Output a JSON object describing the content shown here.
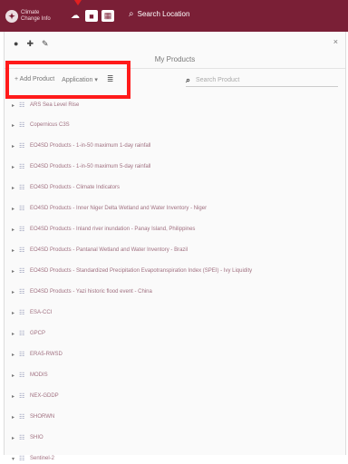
{
  "topbar": {
    "logo_text": "Climate Change Info",
    "search_label": "Search Location",
    "accent": "#7a1f36"
  },
  "panel": {
    "tools": [
      "●",
      "✚",
      "✎"
    ],
    "close": "×",
    "title": "My Products",
    "add_product": "+ Add Product",
    "application": "Application ▾",
    "list_icon": "≣",
    "search_placeholder": "Search Product"
  },
  "tree": [
    {
      "label": "ARS Sea Level Rise",
      "icon": "list-icon",
      "expanded": false
    },
    {
      "label": "Copernicus C3S",
      "icon": "list-icon",
      "expanded": false
    },
    {
      "label": "EO4SD Products - 1-in-50 maximum 1-day rainfall",
      "icon": "list-icon",
      "expanded": false
    },
    {
      "label": "EO4SD Products - 1-in-50 maximum 5-day rainfall",
      "icon": "list-icon",
      "expanded": false
    },
    {
      "label": "EO4SD Products - Climate Indicators",
      "icon": "list-icon",
      "expanded": false
    },
    {
      "label": "EO4SD Products - Inner Niger Delta Wetland and Water Inventory - Niger",
      "icon": "list-icon",
      "expanded": false
    },
    {
      "label": "EO4SD Products - Inland river inundation - Panay Island, Philippines",
      "icon": "list-icon",
      "expanded": false
    },
    {
      "label": "EO4SD Products - Pantanal Wetland and Water Inventory - Brazil",
      "icon": "list-icon",
      "expanded": false
    },
    {
      "label": "EO4SD Products - Standardized Precipitation Evapotranspiration Index (SPEI) - Ivy Liquidity",
      "icon": "list-icon",
      "expanded": false
    },
    {
      "label": "EO4SD Products - Yazi historic flood event - China",
      "icon": "list-icon",
      "expanded": false
    },
    {
      "label": "ESA-CCI",
      "icon": "list-icon",
      "expanded": false
    },
    {
      "label": "GPCP",
      "icon": "list-icon",
      "expanded": false
    },
    {
      "label": "ERA5-RWSD",
      "icon": "list-icon",
      "expanded": false
    },
    {
      "label": "MODIS",
      "icon": "list-icon",
      "expanded": false
    },
    {
      "label": "NEX-GDDP",
      "icon": "list-icon",
      "expanded": false
    },
    {
      "label": "SHORWN",
      "icon": "list-icon",
      "expanded": false
    },
    {
      "label": "SHIO",
      "icon": "list-icon",
      "expanded": false
    },
    {
      "label": "Sentinel-2",
      "icon": "list-icon",
      "expanded": true
    }
  ],
  "highlight_color": "#ff1a1a"
}
